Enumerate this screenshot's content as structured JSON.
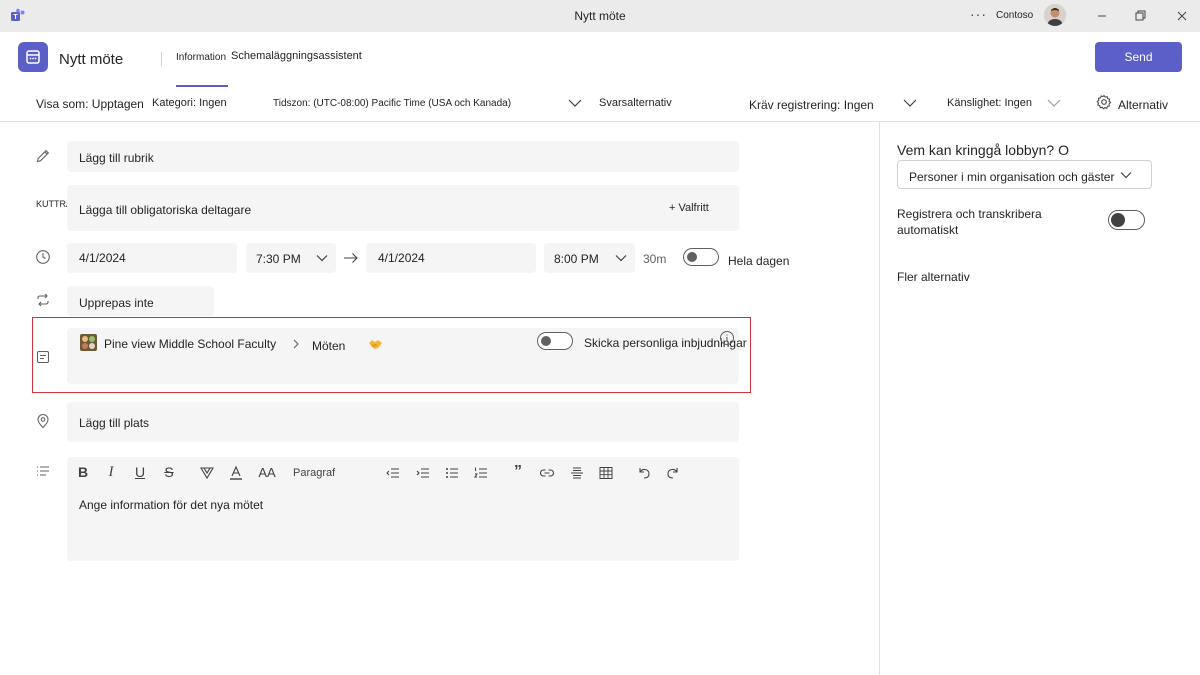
{
  "window": {
    "title": "Nytt möte",
    "org": "Contoso",
    "more_label": "···"
  },
  "header": {
    "title": "Nytt möte",
    "tabs": [
      {
        "label": "Information",
        "active": true
      },
      {
        "label": "Schemaläggningsassistent",
        "active": false
      }
    ],
    "send_label": "Send"
  },
  "options_bar": {
    "show_as": "Visa som: Upptagen",
    "category": "Kategori: Ingen",
    "timezone": "Tidszon: (UTC-08:00) Pacific Time (USA och Kanada)",
    "response_options": "Svarsalternativ",
    "require_registration": "Kräv registrering: Ingen",
    "sensitivity": "Känslighet: Ingen",
    "options": "Alternativ"
  },
  "form": {
    "title_placeholder": "Lägg till rubrik",
    "attendees_label": "KUTTRA",
    "attendees_placeholder": "Lägga till obligatoriska deltagare",
    "optional_label": "+ Valfritt",
    "start_date": "4/1/2024",
    "start_time": "7:30 PM",
    "end_date": "4/1/2024",
    "end_time": "8:00 PM",
    "duration": "30m",
    "all_day_label": "Hela dagen",
    "repeat": "Upprepas inte",
    "channel_team": "Pine view Middle School Faculty",
    "channel_name": "Möten",
    "personal_invites_label": "Skicka personliga inbjudningar",
    "location_placeholder": "Lägg till plats",
    "paragraph_label": "Paragraf",
    "details_placeholder": "Ange information för det nya mötet"
  },
  "right_panel": {
    "lobby_question": "Vem kan kringgå lobbyn? O",
    "lobby_value": "Personer i min organisation och gäster",
    "record_label_line1": "Registrera och transkribera",
    "record_label_line2": "automatiskt",
    "more_options": "Fler alternativ"
  },
  "colors": {
    "accent": "#5b5fc7",
    "highlight": "#d13438",
    "field_bg": "#f5f5f5"
  }
}
